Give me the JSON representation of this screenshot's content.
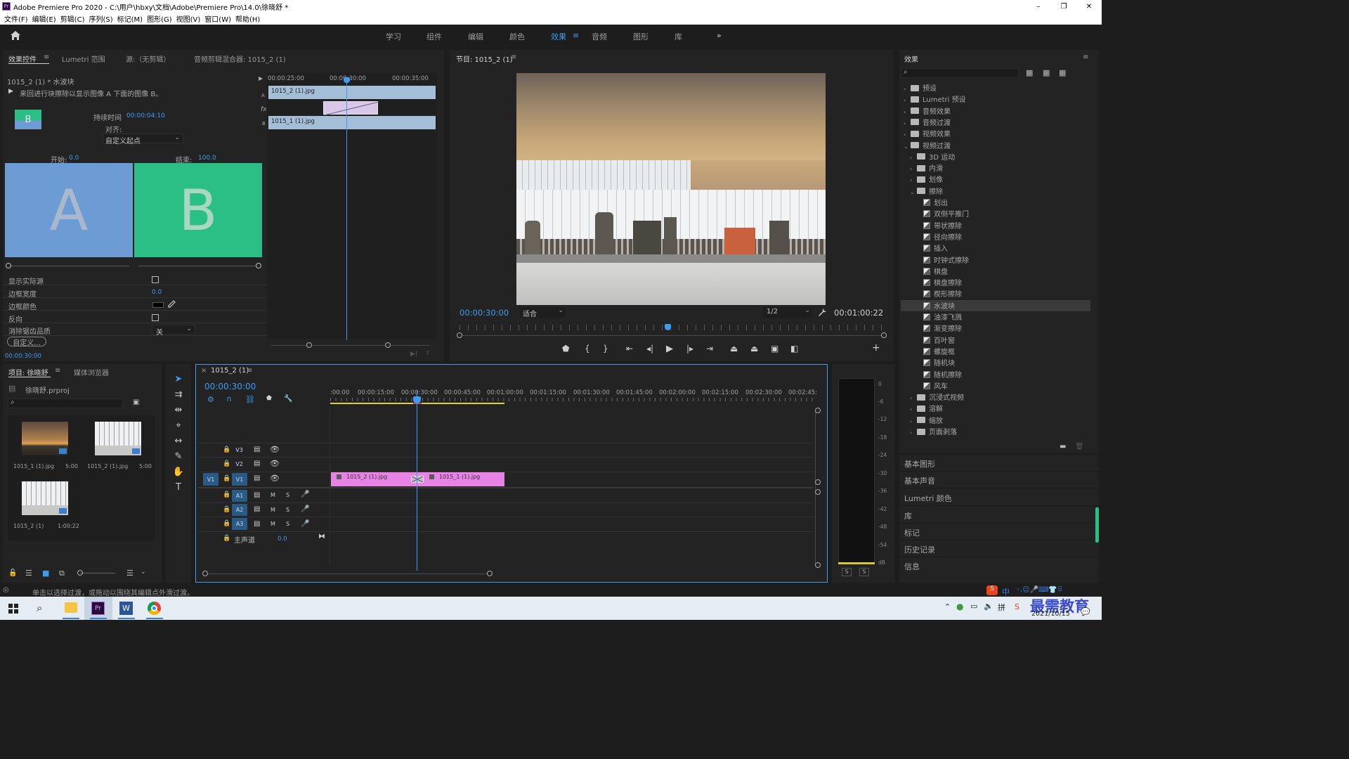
{
  "window": {
    "title": "Adobe Premiere Pro 2020 - C:\\用户\\hbxy\\文档\\Adobe\\Premiere Pro\\14.0\\徐晓舒 *",
    "app_badge": "Pr",
    "minimize": "–",
    "maximize": "❐",
    "close": "✕"
  },
  "menu": [
    "文件(F)",
    "编辑(E)",
    "剪辑(C)",
    "序列(S)",
    "标记(M)",
    "图形(G)",
    "视图(V)",
    "窗口(W)",
    "帮助(H)"
  ],
  "workspace": {
    "tabs": [
      "学习",
      "组件",
      "编辑",
      "颜色",
      "效果",
      "音频",
      "图形",
      "库"
    ],
    "active": "效果",
    "more": "»",
    "menu_icon": "≡"
  },
  "effect_controls": {
    "tabs": [
      "效果控件",
      "Lumetri 范围",
      "源:（无剪辑）",
      "音频剪辑混合器: 1015_2 (1)"
    ],
    "active_tab": "效果控件",
    "menu_icon": "≡",
    "clip_label": "1015_2 (1) * 水波块",
    "description": "来回进行块擦除以显示图像 A 下面的图像 B。",
    "thumb_letter": "B",
    "duration_label": "持续时间",
    "duration_value": "00:00:04:10",
    "align_label": "对齐:",
    "align_value": "自定义起点",
    "start_label": "开始:",
    "start_value": "0.0",
    "end_label": "结束:",
    "end_value": "100.0",
    "preview_a": "A",
    "preview_b": "B",
    "mini_ruler": [
      "00:00:25:00",
      "00:00:30:00",
      "00:00:35:00"
    ],
    "mini_clip_a": "1015_2 (1).jpg",
    "mini_clip_b": "1015_1 (1).jpg",
    "track_a": "A",
    "track_b": "B",
    "fx_icon": "fx",
    "properties": [
      {
        "label": "显示实际源",
        "type": "checkbox",
        "value": ""
      },
      {
        "label": "边框宽度",
        "type": "number",
        "value": "0.0"
      },
      {
        "label": "边框颜色",
        "type": "color",
        "value": ""
      },
      {
        "label": "反向",
        "type": "checkbox",
        "value": ""
      },
      {
        "label": "消除锯齿品质",
        "type": "select",
        "value": "关"
      }
    ],
    "custom_button": "自定义...",
    "timecode": "00:00:30:00"
  },
  "program": {
    "title": "节目: 1015_2 (1)",
    "menu_icon": "≡",
    "timecode": "00:00:30:00",
    "fit": "适合",
    "quality": "1/2",
    "duration": "00:01:00:22",
    "playhead_fraction": 0.49
  },
  "effects": {
    "title": "效果",
    "menu_icon": "≡",
    "items": [
      {
        "level": 0,
        "kind": "folder",
        "arrow": "›",
        "label": "预设"
      },
      {
        "level": 0,
        "kind": "folder",
        "arrow": "›",
        "label": "Lumetri 预设"
      },
      {
        "level": 0,
        "kind": "folder",
        "arrow": "›",
        "label": "音频效果"
      },
      {
        "level": 0,
        "kind": "folder",
        "arrow": "›",
        "label": "音频过渡"
      },
      {
        "level": 0,
        "kind": "folder",
        "arrow": "›",
        "label": "视频效果"
      },
      {
        "level": 0,
        "kind": "folder",
        "arrow": "⌄",
        "label": "视频过渡"
      },
      {
        "level": 1,
        "kind": "folder",
        "arrow": "›",
        "label": "3D 运动"
      },
      {
        "level": 1,
        "kind": "folder",
        "arrow": "›",
        "label": "内滑"
      },
      {
        "level": 1,
        "kind": "folder",
        "arrow": "›",
        "label": "划像"
      },
      {
        "level": 1,
        "kind": "folder",
        "arrow": "⌄",
        "label": "擦除"
      },
      {
        "level": 2,
        "kind": "transition",
        "arrow": "",
        "label": "划出"
      },
      {
        "level": 2,
        "kind": "transition",
        "arrow": "",
        "label": "双侧平推门"
      },
      {
        "level": 2,
        "kind": "transition",
        "arrow": "",
        "label": "带状擦除"
      },
      {
        "level": 2,
        "kind": "transition",
        "arrow": "",
        "label": "径向擦除"
      },
      {
        "level": 2,
        "kind": "transition",
        "arrow": "",
        "label": "插入"
      },
      {
        "level": 2,
        "kind": "transition",
        "arrow": "",
        "label": "时钟式擦除"
      },
      {
        "level": 2,
        "kind": "transition",
        "arrow": "",
        "label": "棋盘"
      },
      {
        "level": 2,
        "kind": "transition",
        "arrow": "",
        "label": "棋盘擦除"
      },
      {
        "level": 2,
        "kind": "transition",
        "arrow": "",
        "label": "楔形擦除"
      },
      {
        "level": 2,
        "kind": "transition",
        "arrow": "",
        "label": "水波块",
        "selected": true
      },
      {
        "level": 2,
        "kind": "transition",
        "arrow": "",
        "label": "油漆飞溅"
      },
      {
        "level": 2,
        "kind": "transition",
        "arrow": "",
        "label": "渐变擦除"
      },
      {
        "level": 2,
        "kind": "transition",
        "arrow": "",
        "label": "百叶窗"
      },
      {
        "level": 2,
        "kind": "transition",
        "arrow": "",
        "label": "螺旋框"
      },
      {
        "level": 2,
        "kind": "transition",
        "arrow": "",
        "label": "随机块"
      },
      {
        "level": 2,
        "kind": "transition",
        "arrow": "",
        "label": "随机擦除"
      },
      {
        "level": 2,
        "kind": "transition",
        "arrow": "",
        "label": "风车"
      },
      {
        "level": 1,
        "kind": "folder",
        "arrow": "›",
        "label": "沉浸式视频"
      },
      {
        "level": 1,
        "kind": "folder",
        "arrow": "›",
        "label": "溶解"
      },
      {
        "level": 1,
        "kind": "folder",
        "arrow": "›",
        "label": "缩放"
      },
      {
        "level": 1,
        "kind": "folder",
        "arrow": "›",
        "label": "页面剥落"
      }
    ],
    "side_panels": [
      "基本图形",
      "基本声音",
      "Lumetri 颜色",
      "库",
      "标记",
      "历史记录",
      "信息"
    ]
  },
  "project": {
    "tabs": [
      "项目: 徐晓舒",
      "媒体浏览器"
    ],
    "menu_icon": "≡",
    "file": "徐晓舒.prproj",
    "items": [
      {
        "name": "1015_1 (1).jpg",
        "duration": "5:00"
      },
      {
        "name": "1015_2 (1).jpg",
        "duration": "5:00"
      },
      {
        "name": "1015_2 (1)",
        "duration": "1:00:22"
      }
    ]
  },
  "timeline": {
    "tab": "1015_2 (1)",
    "close": "×",
    "menu_icon": "≡",
    "timecode": "00:00:30:00",
    "ruler": [
      ":00:00",
      "00:00:15:00",
      "00:00:30:00",
      "00:00:45:00",
      "00:01:00:00",
      "00:01:15:00",
      "00:01:30:00",
      "00:01:45:00",
      "00:02:00:00",
      "00:02:15:00",
      "00:02:30:00",
      "00:02:45:"
    ],
    "video_tracks": [
      "V3",
      "V2",
      "V1"
    ],
    "audio_tracks": [
      "A1",
      "A2",
      "A3"
    ],
    "source_patch": "V1",
    "mute": "M",
    "solo": "S",
    "master_label": "主声道",
    "master_value": "0.0",
    "clip_1": "1015_2 (1).jpg",
    "clip_2": "1015_1 (1).jpg"
  },
  "meter": {
    "labels": [
      "0",
      "-6",
      "-12",
      "-18",
      "-24",
      "-30",
      "-36",
      "-42",
      "-48",
      "-54",
      "dB"
    ],
    "solo": [
      "S",
      "S"
    ]
  },
  "status": {
    "text": "单击以选择过渡，或拖动以围绕其编辑点外滑过渡。"
  },
  "taskbar": {
    "date": "2021/10/15",
    "brand": "最需教育",
    "ime": "中",
    "apps": [
      "Pr",
      "W"
    ]
  },
  "colors": {
    "accent": "#3d9cf0",
    "clip_pink": "#e883e6",
    "clip_blue": "#a4bed8",
    "a_blue": "#6d9bd4",
    "b_green": "#2bbf86"
  }
}
